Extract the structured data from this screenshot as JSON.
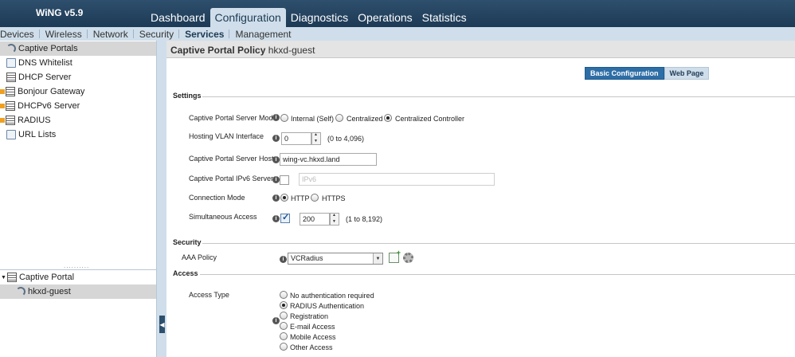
{
  "app": {
    "title": "WiNG v5.9"
  },
  "main_tabs": [
    "Dashboard",
    "Configuration",
    "Diagnostics",
    "Operations",
    "Statistics"
  ],
  "sub_tabs": [
    "Devices",
    "Wireless",
    "Network",
    "Security",
    "Services",
    "Management"
  ],
  "sidebar": {
    "items": [
      {
        "label": "Captive Portals",
        "icon": "wifi-icon"
      },
      {
        "label": "DNS Whitelist",
        "icon": "file-icon"
      },
      {
        "label": "DHCP Server",
        "icon": "table-icon"
      },
      {
        "label": "Bonjour Gateway",
        "icon": "table-icon"
      },
      {
        "label": "DHCPv6 Server",
        "icon": "table-icon"
      },
      {
        "label": "RADIUS",
        "icon": "table-icon"
      },
      {
        "label": "URL Lists",
        "icon": "file-icon"
      }
    ],
    "tree": {
      "root": "Captive Portal",
      "child": "hkxd-guest"
    }
  },
  "panel": {
    "title": "Captive Portal Policy",
    "name": "hkxd-guest",
    "tabs": [
      "Basic Configuration",
      "Web Page"
    ]
  },
  "settings": {
    "section": "Settings",
    "server_mode": {
      "label": "Captive Portal Server Mode",
      "options": [
        "Internal (Self)",
        "Centralized",
        "Centralized Controller"
      ],
      "selected": "Centralized Controller"
    },
    "vlan": {
      "label": "Hosting VLAN Interface",
      "value": "0",
      "range": "(0 to 4,096)"
    },
    "server_host": {
      "label": "Captive Portal Server Host",
      "value": "wing-vc.hkxd.land"
    },
    "ipv6_server": {
      "label": "Captive Portal IPv6 Server",
      "placeholder": "IPv6"
    },
    "connection_mode": {
      "label": "Connection Mode",
      "options": [
        "HTTP",
        "HTTPS"
      ],
      "selected": "HTTP"
    },
    "simultaneous": {
      "label": "Simultaneous Access",
      "value": "200",
      "range": "(1 to 8,192)"
    }
  },
  "security": {
    "section": "Security",
    "aaa_policy": {
      "label": "AAA Policy",
      "value": "VCRadius"
    }
  },
  "access": {
    "section": "Access",
    "access_type": {
      "label": "Access Type",
      "options": [
        "No authentication required",
        "RADIUS Authentication",
        "Registration",
        "E-mail Access",
        "Mobile Access",
        "Other Access"
      ],
      "selected": "RADIUS Authentication"
    }
  }
}
